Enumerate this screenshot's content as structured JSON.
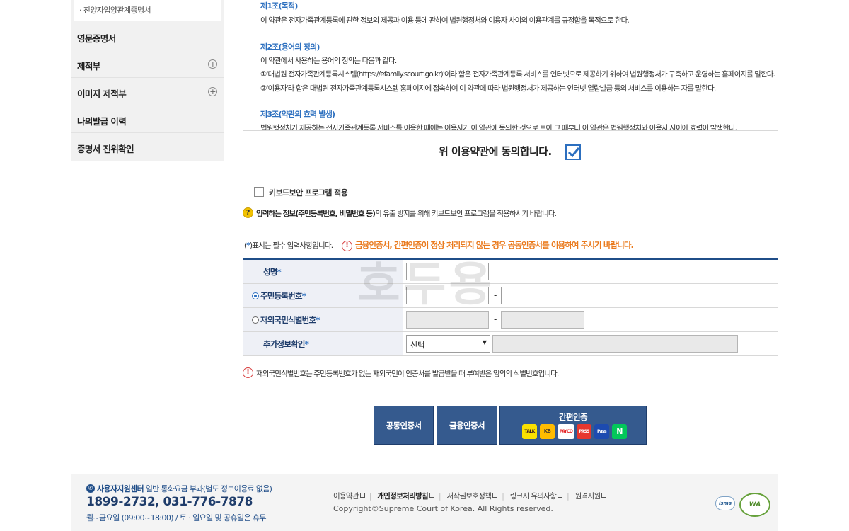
{
  "sidebar": {
    "sub_item": "· 친양자입양관계증명서",
    "items": [
      {
        "label": "영문증명서",
        "expandable": false
      },
      {
        "label": "제적부",
        "expandable": true
      },
      {
        "label": "이미지 제적부",
        "expandable": true
      },
      {
        "label": "나의발급 이력",
        "expandable": false
      },
      {
        "label": "증명서 진위확인",
        "expandable": false
      }
    ]
  },
  "terms": {
    "art1_title": "제1조(목적)",
    "art1_text": "이 약관은 전자가족관계등록에 관한 정보의 제공과 이용 등에 관하여 법원행정처와 이용자 사이의 이용관계를 규정함을 목적으로 한다.",
    "art2_title": "제2조(용어의 정의)",
    "art2_text": "이 약관에서 사용하는 용어의 정의는 다음과 같다.",
    "art2_item1": "①'대법원 전자가족관계등록시스템(https://efamily.scourt.go.kr)'이라 함은 전자가족관계등록 서비스를 인터넷으로 제공하기 위하여 법원행정처가 구축하고 운영하는 홈페이지를 말한다.",
    "art2_item2": "②'이용자'라 함은 대법원 전자가족관계등록시스템 홈페이지에 접속하여 이 약관에 따라 법원행정처가 제공하는 인터넷 열람발급 등의 서비스를 이용하는 자를 말한다.",
    "art3_title": "제3조(약관의 효력 발생)",
    "art3_text": "법원행정처가 제공하는 전자가족관계등록 서비스를 이용한 때에는 이용자가 이 약관에 동의한 것으로 보아 그 때부터 이 약관은 법원행정처와 이용자 사이에 효력이 발생한다."
  },
  "agree": {
    "label": "위 이용약관에 동의합니다.",
    "checked": true
  },
  "keyboard": {
    "button_label": "키보드보안 프로그램 적용",
    "note_bold": "입력하는 정보(주민등록번호, 비밀번호 등)",
    "note_rest": "의 유출 방지를 위해 키보드보안 프로그램을 적용하시기 바랍니다."
  },
  "required_note": {
    "open": "(",
    "star": "*",
    "text": ")표시는 필수 입력사항입니다."
  },
  "cert_warning": "금융인증서, 간편인증이 정상 처리되지 않는 경우 공동인증서를 이용하여 주시기 바랍니다.",
  "watermark": "호두용",
  "form": {
    "name_label": "성명",
    "rrn_label": "주민등록번호",
    "foreign_label": "재외국민식별번호",
    "extra_label": "추가정보확인",
    "star": "*",
    "dash": "-",
    "select_value": "선택",
    "selected_id_type": "rrn"
  },
  "foreign_note": "재외국민식별번호는 주민등록번호가 없는 재외국민이 인증서를 발급받을 때 부여받은 임의의 식별번호입니다.",
  "cert_buttons": {
    "joint": "공동인증서",
    "financial": "금융인증서",
    "simple": "간편인증",
    "providers": [
      "TALK",
      "KB",
      "PAYCO",
      "PASS",
      "Pass",
      "N"
    ]
  },
  "footer": {
    "center_bold": "사용자지원센터",
    "center_rest": " 일반 통화요금 부과(별도 정보이용료 없음)",
    "phone": "1899-2732, 031-776-7878",
    "hours": "월~금요일 (09:00~18:00) / 토 · 일요일 및 공휴일은 휴무",
    "links": [
      "이용약관",
      "개인정보처리방침",
      "저작권보호정책",
      "링크시 유의사항",
      "원격지원"
    ],
    "copyright": "Copyright©Supreme Court of Korea. All Rights reserved.",
    "badge_isms": "isms",
    "badge_wa": "WA"
  },
  "colors": {
    "accent": "#2c6fbf",
    "navy": "#1f4d88",
    "button": "#355a8e",
    "warning": "#ea7a1d",
    "error": "#d63a3a"
  }
}
